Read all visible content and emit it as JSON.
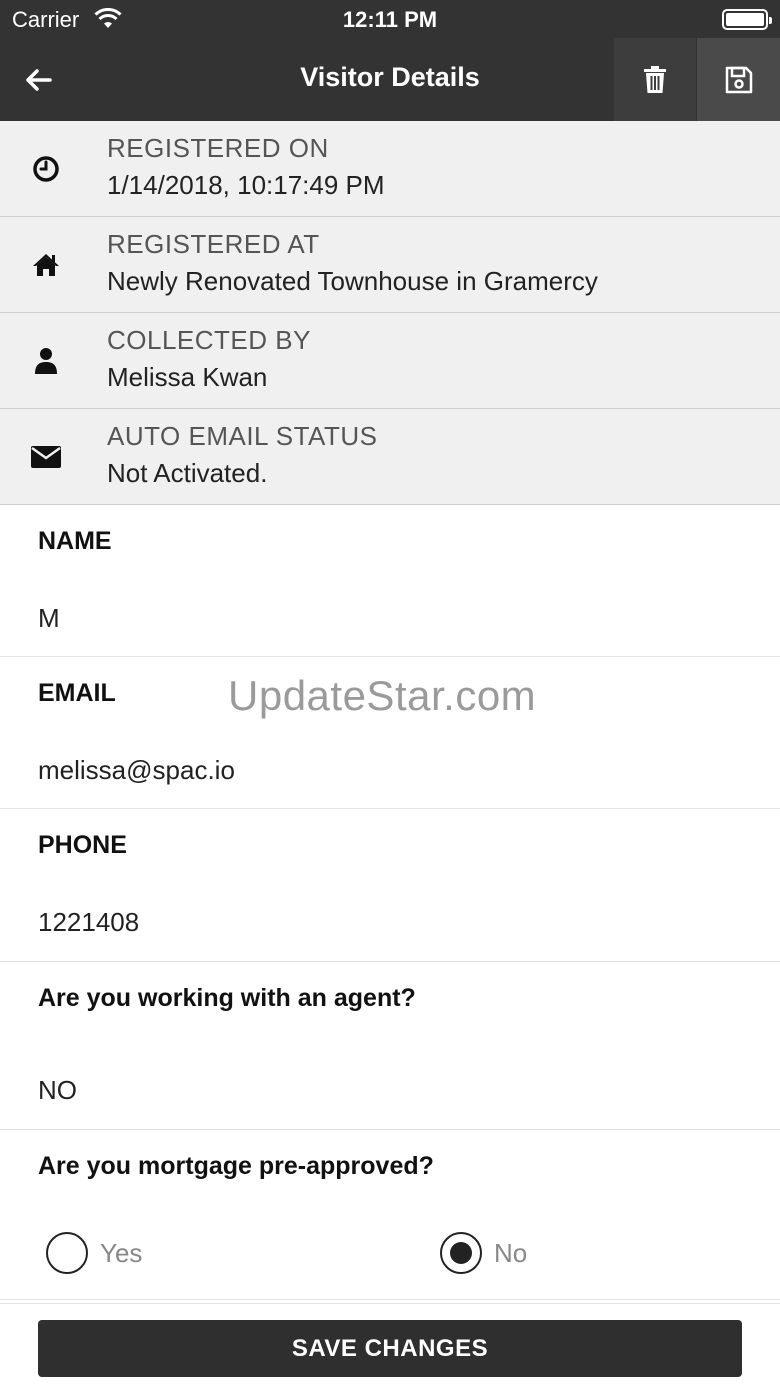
{
  "status_bar": {
    "carrier": "Carrier",
    "time": "12:11 PM"
  },
  "nav": {
    "title": "Visitor Details",
    "back_icon": "arrow-left-icon",
    "delete_icon": "trash-icon",
    "save_icon": "floppy-disk-icon",
    "background": "#333333"
  },
  "info": [
    {
      "icon": "clock-icon",
      "label": "REGISTERED ON",
      "value": "1/14/2018, 10:17:49 PM"
    },
    {
      "icon": "home-icon",
      "label": "REGISTERED AT",
      "value": "Newly Renovated Townhouse in Gramercy"
    },
    {
      "icon": "user-icon",
      "label": "COLLECTED BY",
      "value": "Melissa Kwan"
    },
    {
      "icon": "envelope-icon",
      "label": "AUTO EMAIL STATUS",
      "value": "Not Activated."
    }
  ],
  "form": {
    "name": {
      "label": "NAME",
      "value": "M"
    },
    "email": {
      "label": "EMAIL",
      "value": "melissa@spac.io"
    },
    "phone": {
      "label": "PHONE",
      "value": "1221408"
    },
    "agent": {
      "label": "Are you working with an agent?",
      "value": "NO"
    },
    "mortgage": {
      "label": "Are you mortgage pre-approved?",
      "options": [
        {
          "label": "Yes",
          "selected": false
        },
        {
          "label": "No",
          "selected": true
        }
      ]
    }
  },
  "watermark": "UpdateStar.com",
  "footer": {
    "save_label": "SAVE CHANGES"
  }
}
